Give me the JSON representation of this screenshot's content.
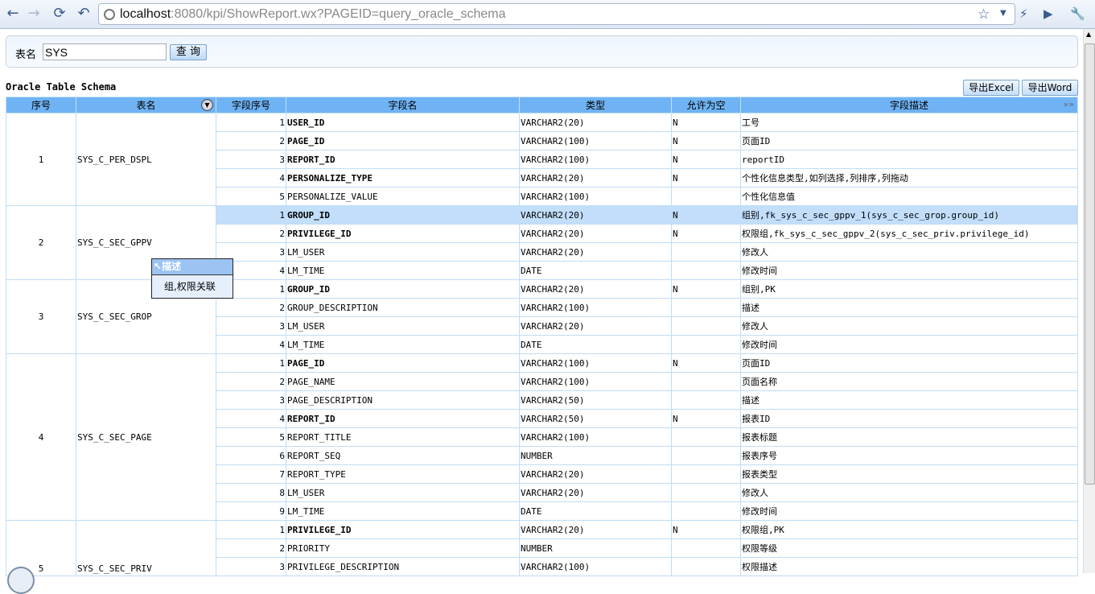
{
  "browser": {
    "url_host": "localhost",
    "url_rest": ":8080/kpi/ShowReport.wx?PAGEID=query_oracle_schema"
  },
  "query": {
    "label": "表名",
    "value": "SYS",
    "button": "查 询"
  },
  "report": {
    "title": "Oracle Table Schema",
    "export_excel": "导出Excel",
    "export_word": "导出Word"
  },
  "columns": [
    "序号",
    "表名",
    "字段序号",
    "字段名",
    "类型",
    "允许为空",
    "字段描述"
  ],
  "tooltip": {
    "title": "描述",
    "text": "组,权限关联"
  },
  "groups": [
    {
      "no": "1",
      "table": "SYS_C_PER_DSPL",
      "fields": [
        [
          "1",
          "USER_ID",
          "VARCHAR2(20)",
          "N",
          "工号"
        ],
        [
          "2",
          "PAGE_ID",
          "VARCHAR2(100)",
          "N",
          "页面ID"
        ],
        [
          "3",
          "REPORT_ID",
          "VARCHAR2(100)",
          "N",
          "reportID"
        ],
        [
          "4",
          "PERSONALIZE_TYPE",
          "VARCHAR2(20)",
          "N",
          "个性化信息类型,如列选择,列排序,列拖动"
        ],
        [
          "5",
          "PERSONALIZE_VALUE",
          "VARCHAR2(100)",
          "",
          "个性化信息值"
        ]
      ]
    },
    {
      "no": "2",
      "table": "SYS_C_SEC_GPPV",
      "fields": [
        [
          "1",
          "GROUP_ID",
          "VARCHAR2(20)",
          "N",
          "组别,fk_sys_c_sec_gppv_1(sys_c_sec_grop.group_id)"
        ],
        [
          "2",
          "PRIVILEGE_ID",
          "VARCHAR2(20)",
          "N",
          "权限组,fk_sys_c_sec_gppv_2(sys_c_sec_priv.privilege_id)"
        ],
        [
          "3",
          "LM_USER",
          "VARCHAR2(20)",
          "",
          "修改人"
        ],
        [
          "4",
          "LM_TIME",
          "DATE",
          "",
          "修改时间"
        ]
      ]
    },
    {
      "no": "3",
      "table": "SYS_C_SEC_GROP",
      "fields": [
        [
          "1",
          "GROUP_ID",
          "VARCHAR2(20)",
          "N",
          "组别,PK"
        ],
        [
          "2",
          "GROUP_DESCRIPTION",
          "VARCHAR2(100)",
          "",
          "描述"
        ],
        [
          "3",
          "LM_USER",
          "VARCHAR2(20)",
          "",
          "修改人"
        ],
        [
          "4",
          "LM_TIME",
          "DATE",
          "",
          "修改时间"
        ]
      ]
    },
    {
      "no": "4",
      "table": "SYS_C_SEC_PAGE",
      "fields": [
        [
          "1",
          "PAGE_ID",
          "VARCHAR2(100)",
          "N",
          "页面ID"
        ],
        [
          "2",
          "PAGE_NAME",
          "VARCHAR2(100)",
          "",
          "页面名称"
        ],
        [
          "3",
          "PAGE_DESCRIPTION",
          "VARCHAR2(50)",
          "",
          "描述"
        ],
        [
          "4",
          "REPORT_ID",
          "VARCHAR2(50)",
          "N",
          "报表ID"
        ],
        [
          "5",
          "REPORT_TITLE",
          "VARCHAR2(100)",
          "",
          "报表标题"
        ],
        [
          "6",
          "REPORT_SEQ",
          "NUMBER",
          "",
          "报表序号"
        ],
        [
          "7",
          "REPORT_TYPE",
          "VARCHAR2(20)",
          "",
          "报表类型"
        ],
        [
          "8",
          "LM_USER",
          "VARCHAR2(20)",
          "",
          "修改人"
        ],
        [
          "9",
          "LM_TIME",
          "DATE",
          "",
          "修改时间"
        ]
      ]
    },
    {
      "no": "5",
      "table": "SYS_C_SEC_PRIV",
      "fields": [
        [
          "1",
          "PRIVILEGE_ID",
          "VARCHAR2(20)",
          "N",
          "权限组,PK"
        ],
        [
          "2",
          "PRIORITY",
          "NUMBER",
          "",
          "权限等级"
        ],
        [
          "3",
          "PRIVILEGE_DESCRIPTION",
          "VARCHAR2(100)",
          "",
          "权限描述"
        ]
      ]
    }
  ]
}
